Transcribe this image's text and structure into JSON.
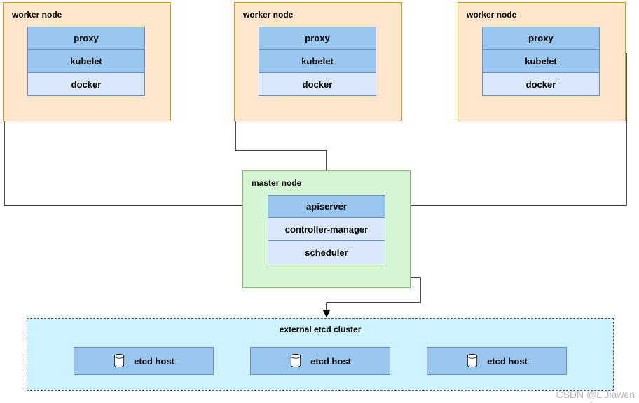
{
  "workers": [
    {
      "title": "worker node",
      "items": {
        "proxy": "proxy",
        "kubelet": "kubelet",
        "docker": "docker"
      }
    },
    {
      "title": "worker node",
      "items": {
        "proxy": "proxy",
        "kubelet": "kubelet",
        "docker": "docker"
      }
    },
    {
      "title": "worker node",
      "items": {
        "proxy": "proxy",
        "kubelet": "kubelet",
        "docker": "docker"
      }
    }
  ],
  "master": {
    "title": "master node",
    "items": {
      "apiserver": "apiserver",
      "cmgr": "controller-manager",
      "sched": "scheduler"
    }
  },
  "etcd": {
    "title": "external etcd cluster",
    "hosts": [
      "etcd host",
      "etcd host",
      "etcd host"
    ]
  },
  "watermark": "CSDN @L Jiawen"
}
